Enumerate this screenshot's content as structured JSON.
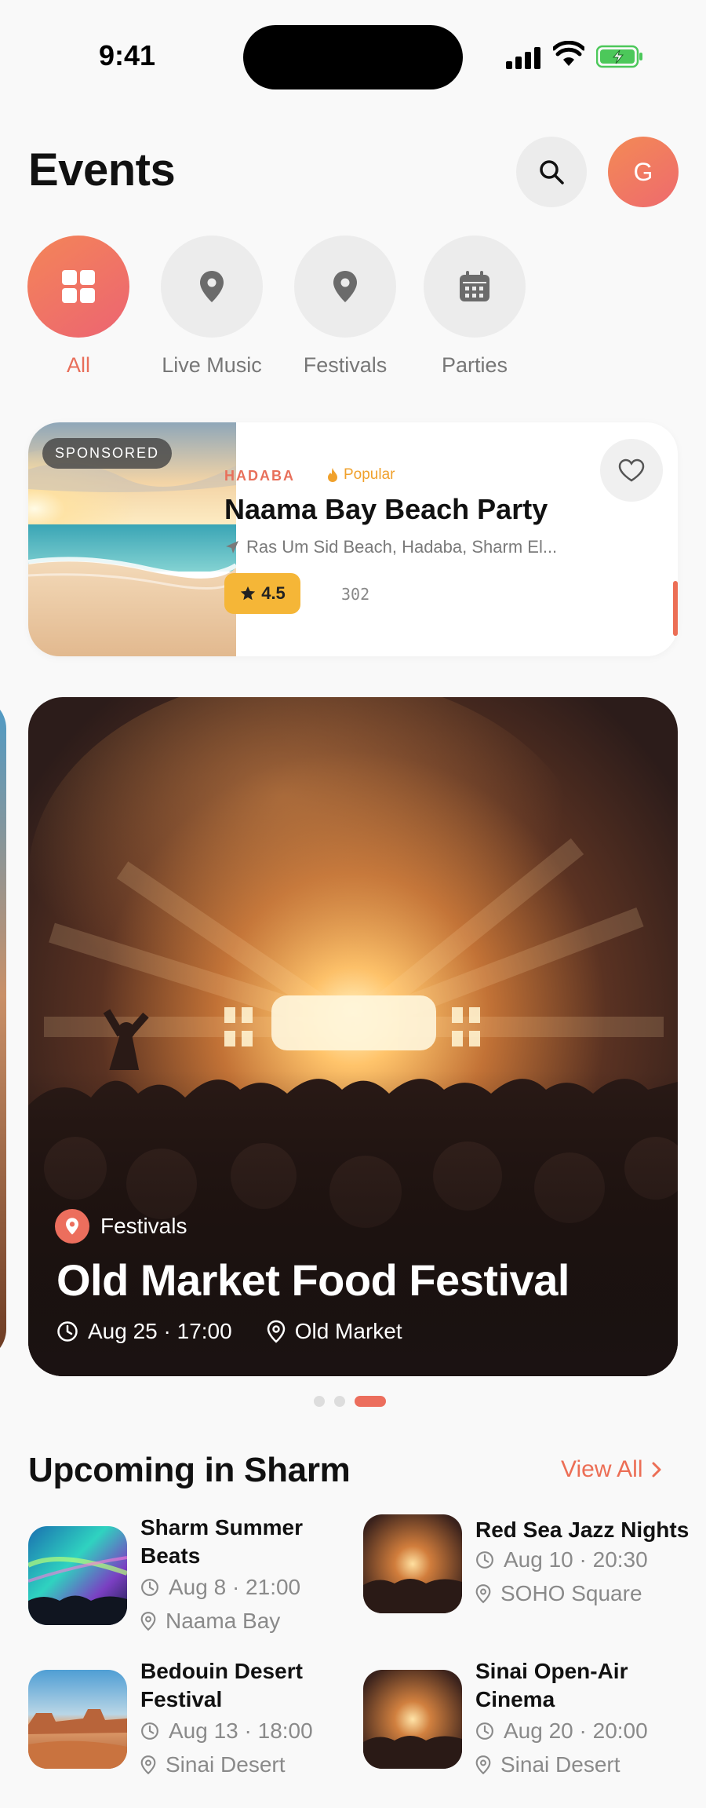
{
  "status_bar": {
    "time": "9:41"
  },
  "header": {
    "title": "Events",
    "avatar_initial": "G"
  },
  "categories": [
    {
      "label": "All",
      "icon": "grid-icon"
    },
    {
      "label": "Live Music",
      "icon": "map-pin-icon"
    },
    {
      "label": "Festivals",
      "icon": "map-pin-icon"
    },
    {
      "label": "Parties",
      "icon": "calendar-icon"
    }
  ],
  "sponsored": {
    "badge": "SPONSORED",
    "brand": "HADABA",
    "tag": "Popular",
    "title": "Naama Bay Beach Party",
    "location": "Ras Um Sid Beach, Hadaba, Sharm El...",
    "rating": "4.5",
    "count": "302"
  },
  "featured": {
    "category": "Festivals",
    "title": "Old Market Food Festival",
    "datetime": "Aug 25 · 17:00",
    "location": "Old Market"
  },
  "upcoming": {
    "title": "Upcoming in Sharm",
    "view_all": "View All",
    "items": [
      {
        "title": "Sharm Summer Beats",
        "datetime": "Aug 8 · 21:00",
        "location": "Naama Bay"
      },
      {
        "title": "Red Sea Jazz Nights",
        "datetime": "Aug 10 · 20:30",
        "location": "SOHO Square"
      },
      {
        "title": "Bedouin Desert Festival",
        "datetime": "Aug 13 · 18:00",
        "location": "Sinai Desert"
      },
      {
        "title": "Sinai Open-Air Cinema",
        "datetime": "Aug 20 · 20:00",
        "location": "Sinai Desert"
      }
    ]
  },
  "colors": {
    "accent": "#ec6e55",
    "rating": "#f5b637",
    "background": "#f9f9f9"
  }
}
